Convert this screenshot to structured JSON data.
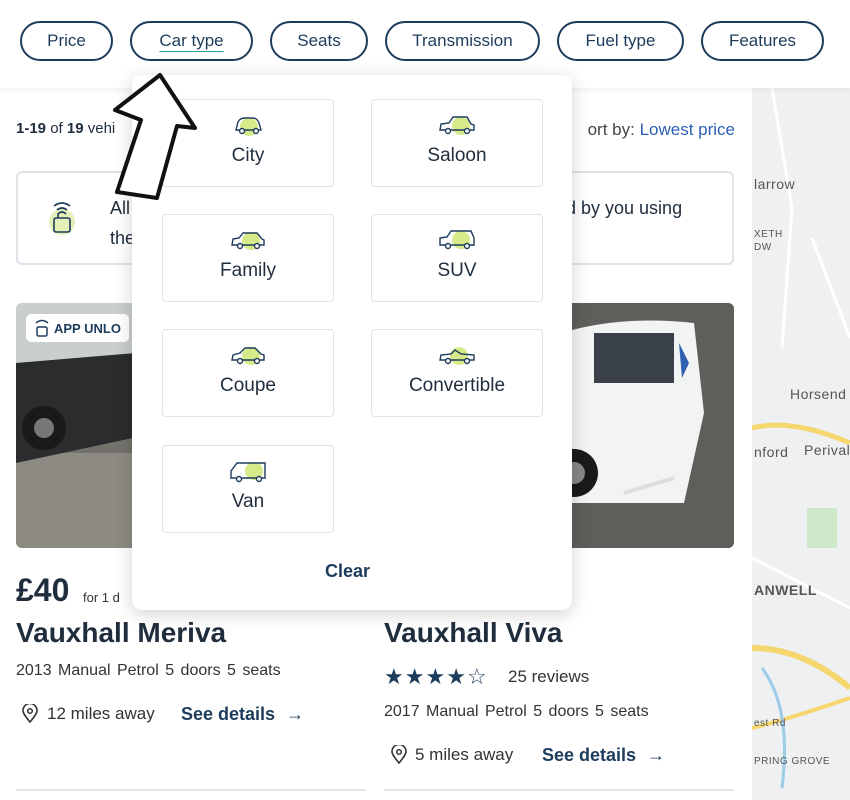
{
  "filters": [
    {
      "label": "Price"
    },
    {
      "label": "Car type"
    },
    {
      "label": "Seats"
    },
    {
      "label": "Transmission"
    },
    {
      "label": "Fuel type"
    },
    {
      "label": "Features"
    }
  ],
  "results": {
    "count_range": "1-19",
    "of": "of",
    "total": "19",
    "suffix": "vehi",
    "sort_prefix": "ort by:",
    "sort_value": "Lowest price"
  },
  "notice": {
    "line1_left": "All",
    "line2_left": "the",
    "line1_right": "d by you using"
  },
  "car_type_dropdown": {
    "options": [
      {
        "label": "City"
      },
      {
        "label": "Saloon"
      },
      {
        "label": "Family"
      },
      {
        "label": "SUV"
      },
      {
        "label": "Coupe"
      },
      {
        "label": "Convertible"
      },
      {
        "label": "Van"
      }
    ],
    "clear_label": "Clear"
  },
  "cards": [
    {
      "badge": "APP UNLO",
      "price": "£40",
      "price_sub": "for 1 d",
      "name": "Vauxhall Meriva",
      "specs": "2013 Manual Petrol 5 doors 5 seats",
      "distance": "12 miles away",
      "details_label": "See details"
    },
    {
      "name": "Vauxhall Viva",
      "rating": 4,
      "max_rating": 5,
      "reviews": "25 reviews",
      "specs": "2017 Manual Petrol 5 doors 5 seats",
      "distance": "5 miles away",
      "details_label": "See details"
    }
  ],
  "map": {
    "labels": [
      "larrow",
      "XETH",
      "DW",
      "Horsend",
      "nford",
      "Perival",
      "ANWELL",
      "est Rd",
      "PRING GROVE"
    ]
  },
  "colors": {
    "brand_navy": "#1d3c5c",
    "accent_teal": "#2a9d8f",
    "link_blue": "#2b5fb3",
    "icon_green": "#c9e06a"
  }
}
